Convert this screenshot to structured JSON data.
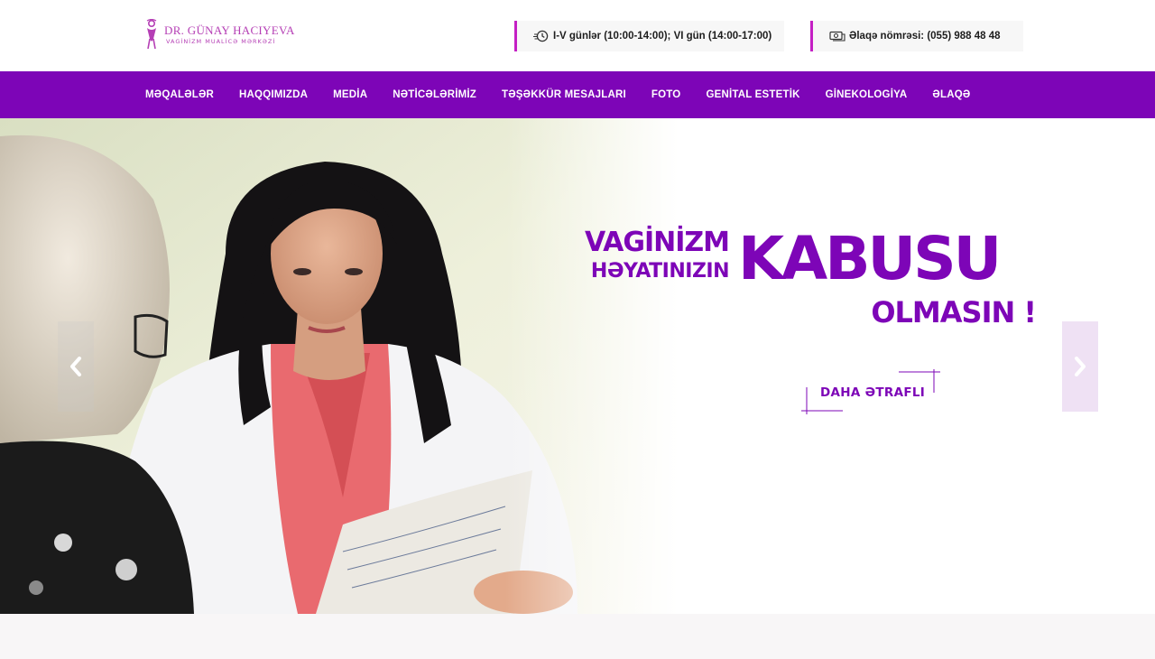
{
  "header": {
    "logo": {
      "name": "DR. GÜNAY HACIYEVA",
      "subtitle": "VAGİNİZM MUALİCƏ MƏRKƏZİ"
    },
    "hours": "I-V günlər (10:00-14:00); VI gün (14:00-17:00)",
    "phone": "Əlaqə nömrəsi: (055) 988 48 48"
  },
  "nav": {
    "items": [
      "MƏQALƏLƏR",
      "HAQQIMIZDA",
      "MEDİA",
      "NƏTİCƏLƏRİMİZ",
      "TƏŞƏKKÜR MESAJLARI",
      "FOTO",
      "GENİTAL ESTETİK",
      "GİNEKOLOGİYA",
      "ƏLAQƏ"
    ]
  },
  "hero": {
    "line1": "VAGİNİZM",
    "line2": "HƏYATINIZIN",
    "line3": "KABUSU",
    "line4": "OLMASIN !",
    "button": "DAHA ƏTRAFLI"
  },
  "colors": {
    "brand_purple": "#7d05b7",
    "accent_magenta": "#c41fc4",
    "logo_pink": "#b53fb5"
  },
  "icons": {
    "hours": "clock-icon",
    "phone": "money-phone-icon",
    "prev": "chevron-left-icon",
    "next": "chevron-right-icon"
  }
}
